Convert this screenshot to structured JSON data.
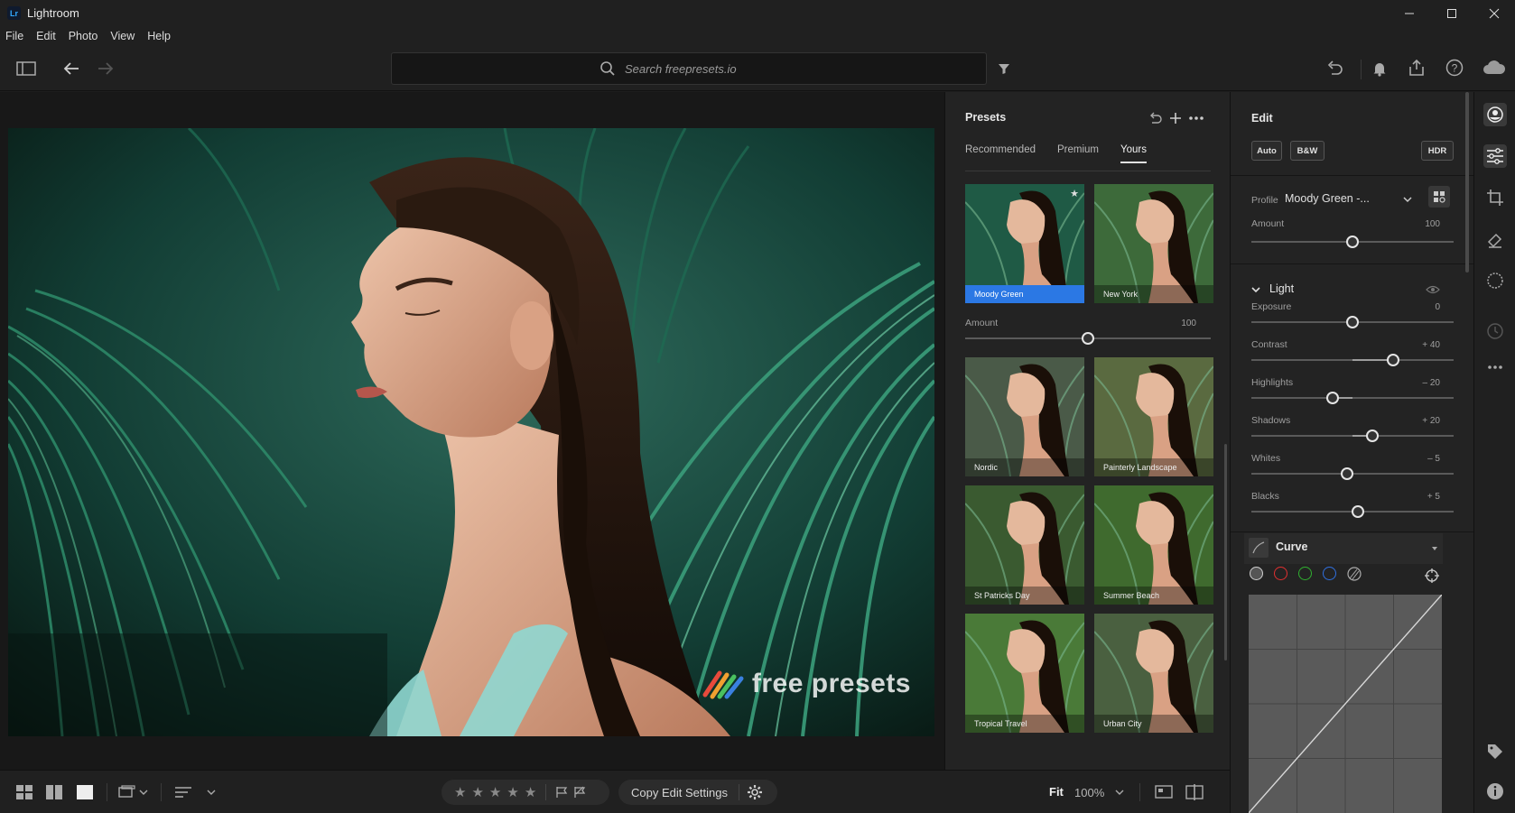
{
  "app": {
    "title": "Lightroom",
    "logo": "Lr"
  },
  "menu": [
    "File",
    "Edit",
    "Photo",
    "View",
    "Help"
  ],
  "search": {
    "placeholder": "Search freepresets.io"
  },
  "watermark": "free presets",
  "presets": {
    "title": "Presets",
    "tabs": [
      {
        "label": "Recommended"
      },
      {
        "label": "Premium"
      },
      {
        "label": "Yours",
        "active": true
      }
    ],
    "amount": {
      "label": "Amount",
      "value": "100",
      "fraction": 0.5
    },
    "items": [
      {
        "name": "Moody Green",
        "selected": true,
        "tint": "#1f5a45"
      },
      {
        "name": "New York",
        "tint": "#3d6a3a"
      },
      {
        "name": "Nordic",
        "tint": "#4a5a48"
      },
      {
        "name": "Painterly Landscape",
        "tint": "#5a6a40"
      },
      {
        "name": "St Patricks Day",
        "tint": "#3a5a30"
      },
      {
        "name": "Summer Beach",
        "tint": "#3f6a2e"
      },
      {
        "name": "Tropical Travel",
        "tint": "#4a7a38"
      },
      {
        "name": "Urban City",
        "tint": "#4a6040"
      }
    ]
  },
  "edit": {
    "title": "Edit",
    "buttons": [
      "Auto",
      "B&W",
      "HDR"
    ],
    "profile": {
      "label": "Profile",
      "value": "Moody Green -..."
    },
    "amount": {
      "label": "Amount",
      "value": "100",
      "fraction": 0.5
    },
    "light": {
      "title": "Light",
      "sliders": [
        {
          "label": "Exposure",
          "value": "0",
          "fraction": 0.5
        },
        {
          "label": "Contrast",
          "value": "+ 40",
          "fraction": 0.7
        },
        {
          "label": "Highlights",
          "value": "– 20",
          "fraction": 0.4
        },
        {
          "label": "Shadows",
          "value": "+ 20",
          "fraction": 0.6
        },
        {
          "label": "Whites",
          "value": "– 5",
          "fraction": 0.475
        },
        {
          "label": "Blacks",
          "value": "+ 5",
          "fraction": 0.525
        }
      ]
    },
    "curve": {
      "title": "Curve",
      "channels": [
        "#cfcfcf",
        "#e03030",
        "#30b030",
        "#3070e0"
      ]
    }
  },
  "bottombar": {
    "copy_edit": "Copy Edit Settings",
    "fit": "Fit",
    "zoom": "100%",
    "stars": 5
  },
  "icons": {
    "undo": "undo-icon",
    "bell": "bell-icon",
    "share": "share-icon",
    "help": "help-icon",
    "cloud": "cloud-icon"
  }
}
